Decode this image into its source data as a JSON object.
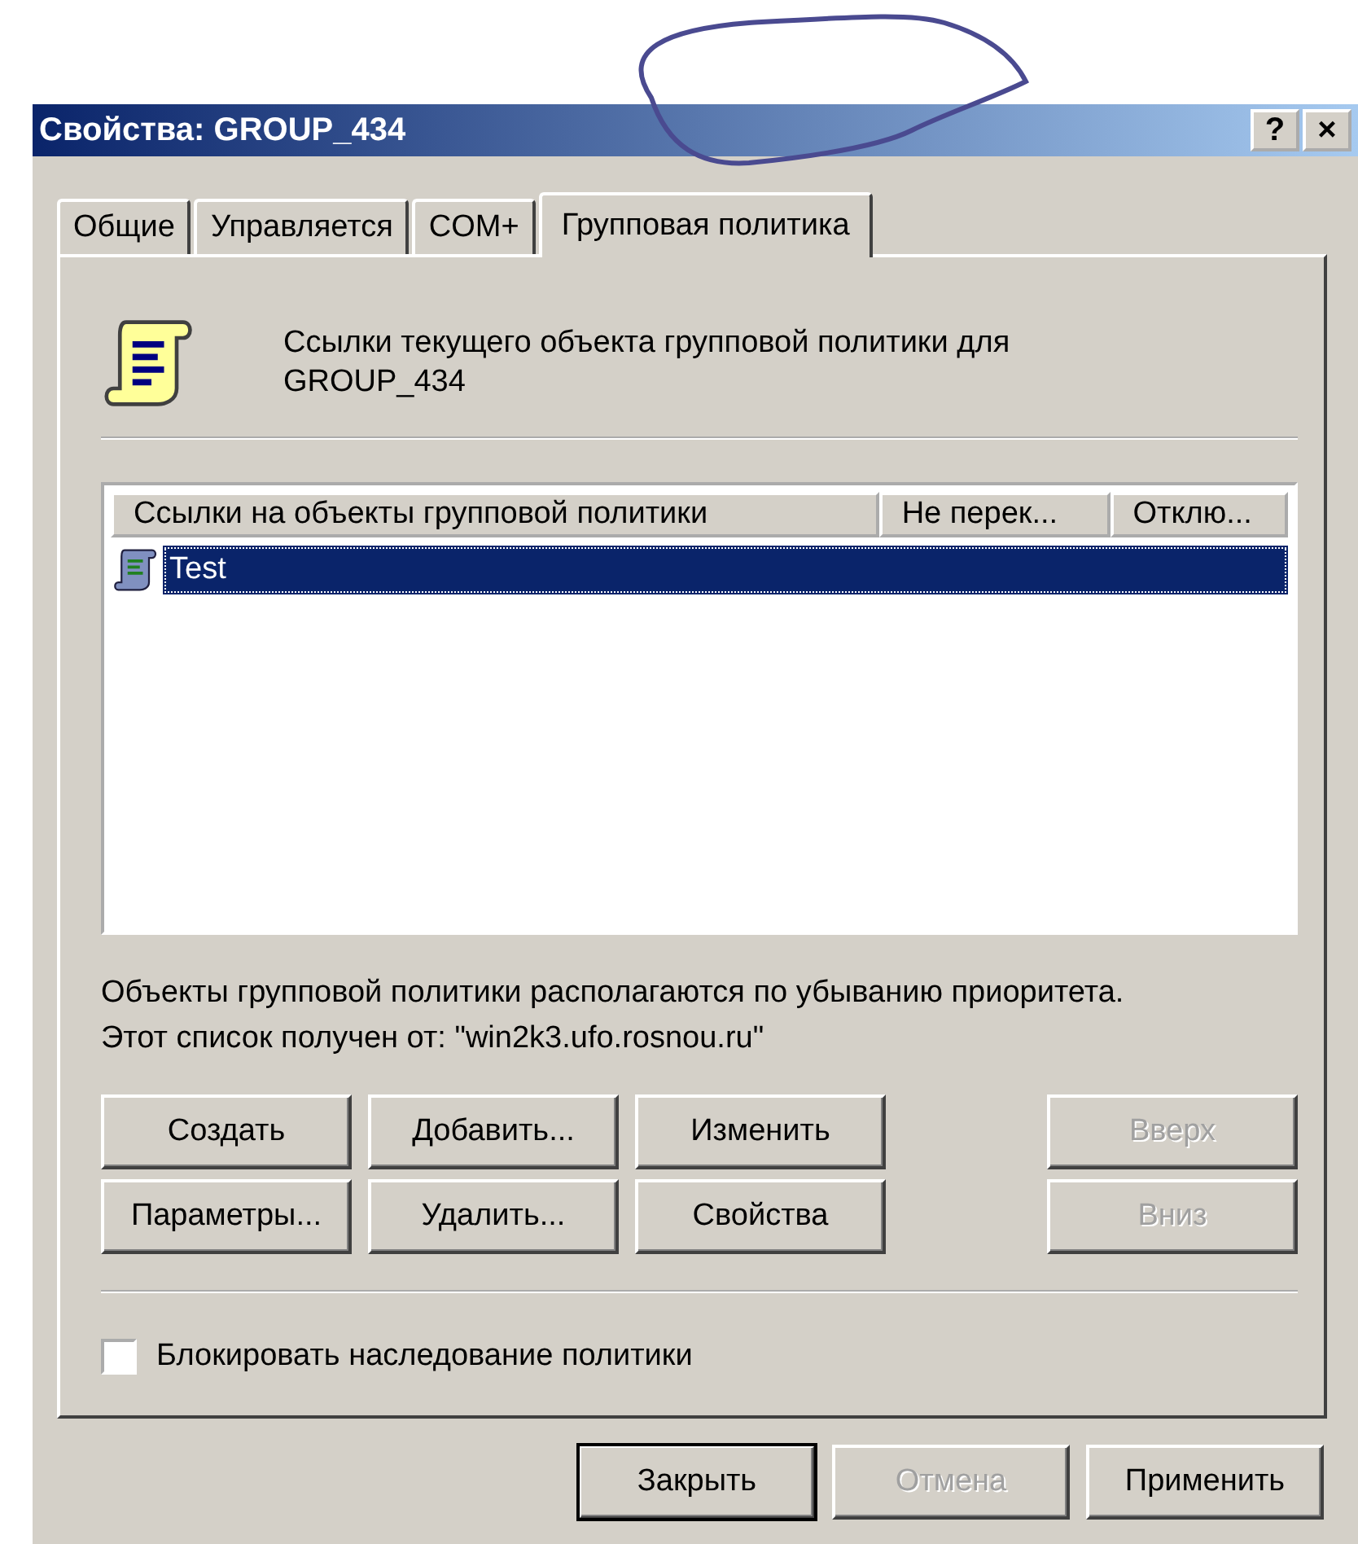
{
  "window": {
    "title": "Свойства: GROUP_434",
    "title_buttons": [
      "?",
      "×"
    ]
  },
  "tabs": [
    {
      "label": "Общие",
      "selected": false
    },
    {
      "label": "Управляется",
      "selected": false
    },
    {
      "label": "COM+",
      "selected": false
    },
    {
      "label": "Групповая политика",
      "selected": true
    }
  ],
  "header": {
    "text": "Ссылки текущего объекта групповой политики для GROUP_434"
  },
  "list": {
    "columns": [
      "Ссылки на объекты групповой политики",
      "Не перек...",
      "Отклю..."
    ],
    "rows": [
      {
        "name": "Test",
        "selected": true
      }
    ]
  },
  "info": [
    "Объекты групповой политики располагаются по убыванию приоритета.",
    "Этот список получен от: \"win2k3.ufo.rosnou.ru\""
  ],
  "action_buttons": [
    [
      {
        "label": "Создать",
        "disabled": false
      },
      {
        "label": "Добавить...",
        "disabled": false
      },
      {
        "label": "Изменить",
        "disabled": false
      }
    ],
    [
      {
        "label": "Параметры...",
        "disabled": false
      },
      {
        "label": "Удалить...",
        "disabled": false
      },
      {
        "label": "Свойства",
        "disabled": false
      }
    ]
  ],
  "order_buttons": [
    {
      "label": "Вверх",
      "disabled": true
    },
    {
      "label": "Вниз",
      "disabled": true
    }
  ],
  "checkbox": {
    "label": "Блокировать наследование политики",
    "checked": false
  },
  "footer_buttons": [
    {
      "label": "Закрыть",
      "disabled": false,
      "default": true
    },
    {
      "label": "Отмена",
      "disabled": true,
      "default": false
    },
    {
      "label": "Применить",
      "disabled": false,
      "default": false
    }
  ]
}
